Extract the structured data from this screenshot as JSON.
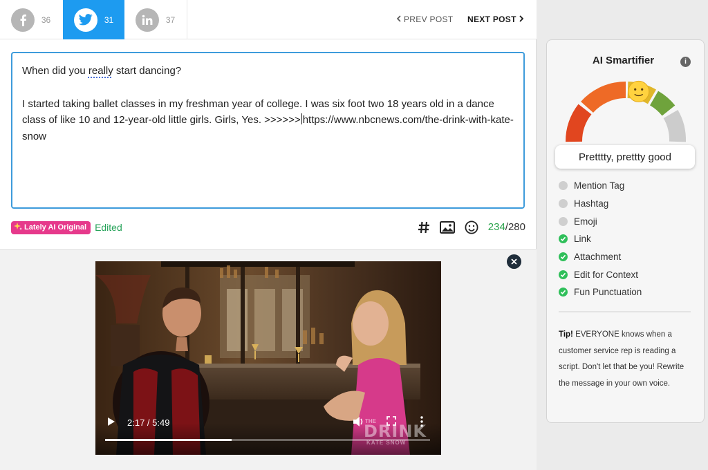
{
  "tabs": [
    {
      "network": "facebook",
      "icon": "facebook-icon",
      "count": "36",
      "active": false
    },
    {
      "network": "twitter",
      "icon": "twitter-icon",
      "count": "31",
      "active": true
    },
    {
      "network": "linkedin",
      "icon": "linkedin-icon",
      "count": "37",
      "active": false
    }
  ],
  "nav": {
    "prev_label": "PREV POST",
    "next_label": "NEXT POST"
  },
  "post": {
    "line1_pre": "When did you ",
    "line1_word": "really",
    "line1_post": " start dancing?",
    "body_pre": "I started taking ballet classes in my freshman year of college. I was six foot two 18 years old in a dance class of like 10 and 12-year-old little girls. Girls, Yes. >>>>>>",
    "body_post": "https://www.nbcnews.com/the-drink-with-kate-snow"
  },
  "status": {
    "badge_label": "Lately AI Original",
    "edited_label": "Edited",
    "char_used": "234",
    "char_max": "/280"
  },
  "video": {
    "time_label": "2:17 / 5:49",
    "progress": 0.39,
    "brand_top": "THE",
    "brand_main": "DRINK",
    "brand_sub": "KATE SNOW"
  },
  "ai": {
    "title": "AI Smartifier",
    "info_icon": "i",
    "score": 0.58,
    "verdict": "Pretttty, prettty good",
    "checklist": [
      {
        "label": "Mention Tag",
        "done": false
      },
      {
        "label": "Hashtag",
        "done": false
      },
      {
        "label": "Emoji",
        "done": false
      },
      {
        "label": "Link",
        "done": true
      },
      {
        "label": "Attachment",
        "done": true
      },
      {
        "label": "Edit for Context",
        "done": true
      },
      {
        "label": "Fun Punctuation",
        "done": true
      }
    ],
    "tip_title": "Tip!",
    "tip_text": " EVERYONE knows when a customer service rep is reading a script. Don't let that be you! Rewrite the message in your own voice."
  },
  "colors": {
    "accent": "#1d9bf0",
    "badge": "#e6398b",
    "success": "#2fbf5a",
    "count_green": "#2da44e"
  }
}
